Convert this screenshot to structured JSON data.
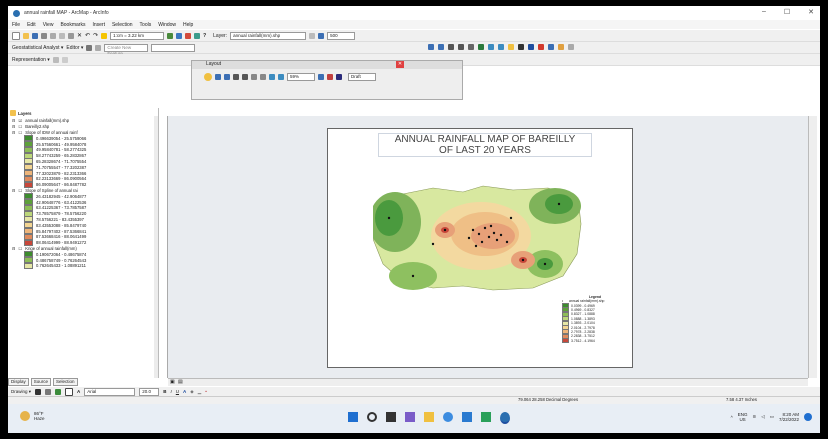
{
  "window": {
    "title": "annual rainfall MAP - ArcMap - ArcInfo",
    "minimize": "–",
    "maximize": "☐",
    "close": "✕"
  },
  "menu": [
    "File",
    "Edit",
    "View",
    "Bookmarks",
    "Insert",
    "Selection",
    "Tools",
    "Window",
    "Help"
  ],
  "toolbar1": {
    "scale": "1:cm = 3.22 km",
    "layer_label": "Layer:",
    "layer_value": "annual rainfall(mm).shp",
    "zoom": "500"
  },
  "toolbar2": {
    "geostat_label": "Geostatistical Analyst ▾",
    "editor_label": "Editor ▾",
    "task_label": "Create New Feature",
    "target_label": ""
  },
  "toolbar3": {
    "representation_label": "Representation ▾"
  },
  "layout_toolbar": {
    "title": "Layout",
    "zoom": "59%",
    "draft": "Draft"
  },
  "toc": {
    "title": "Layers",
    "items": [
      {
        "label": "annual rainfall(mm).shp",
        "kind": "layer",
        "checked": true
      },
      {
        "label": "Bareilly2.shp",
        "kind": "layer",
        "checked": false
      },
      {
        "label": "Slope of IDW of annual rainf",
        "kind": "layer",
        "checked": false
      },
      {
        "label": "0.496639054 - 25.5759066",
        "kind": "class",
        "color": "#3d8c2e"
      },
      {
        "label": "25.57560661 - 49.9584078",
        "kind": "class",
        "color": "#5ea13a"
      },
      {
        "label": "49.95840781 - 58.2774325",
        "kind": "class",
        "color": "#8dbe56"
      },
      {
        "label": "58.27743259 - 65.2832867",
        "kind": "class",
        "color": "#bcd77a"
      },
      {
        "label": "65.28328674 - 71.7075554",
        "kind": "class",
        "color": "#e6e7a6"
      },
      {
        "label": "71.70755547 - 77.3202387",
        "kind": "class",
        "color": "#f3d592"
      },
      {
        "label": "77.32023879 - 82.2313366",
        "kind": "class",
        "color": "#eeb57a"
      },
      {
        "label": "82.23133669 - 86.0900564",
        "kind": "class",
        "color": "#e08a5c"
      },
      {
        "label": "86.09005647 - 86.8487782",
        "kind": "class",
        "color": "#c8473a"
      },
      {
        "label": "Slope of Spline of annual rai",
        "kind": "layer",
        "checked": false
      },
      {
        "label": "26.43182945 - 42.9064877",
        "kind": "class",
        "color": "#3d8c2e"
      },
      {
        "label": "42.90648776 - 63.4122536",
        "kind": "class",
        "color": "#5ea13a"
      },
      {
        "label": "63.41225367 - 73.7857587",
        "kind": "class",
        "color": "#8dbe56"
      },
      {
        "label": "73.78575879 - 78.5756220",
        "kind": "class",
        "color": "#bcd77a"
      },
      {
        "label": "78.5756221 - 83.4355397",
        "kind": "class",
        "color": "#e6e7a6"
      },
      {
        "label": "83.43553088 - 85.8479740",
        "kind": "class",
        "color": "#f3d592"
      },
      {
        "label": "85.84797402 - 87.5366841",
        "kind": "class",
        "color": "#eeb57a"
      },
      {
        "label": "87.53668416 - 88.0641499",
        "kind": "class",
        "color": "#e08a5c"
      },
      {
        "label": "88.06414999 - 88.9491272",
        "kind": "class",
        "color": "#c8473a"
      },
      {
        "label": "Krige of annual rainfall(mm)",
        "kind": "layer",
        "checked": false
      },
      {
        "label": "0.190672064 - 0.48675874",
        "kind": "class",
        "color": "#3d8c2e"
      },
      {
        "label": "0.486758749 - 0.76264543",
        "kind": "class",
        "color": "#8dbe56"
      },
      {
        "label": "0.762645433 - 1.08891211",
        "kind": "class",
        "color": "#e6e7a6"
      }
    ]
  },
  "toc_tabs": [
    "Display",
    "Source",
    "Selection"
  ],
  "drawing_toolbar": {
    "drawing_label": "Drawing ▾",
    "font": "Arial",
    "size": "20.0",
    "bold": "B",
    "italic": "I",
    "underline": "U"
  },
  "map": {
    "title_line1": "ANNUAL RAINFALL MAP OF BAREILLY",
    "title_line2": "OF LAST 20 YEARS",
    "legend_title": "Legend",
    "legend_items": [
      {
        "label": "annual rainfall(mm).shp",
        "color": "#000000"
      },
      {
        "label": "0.0399 - 0.4969",
        "color": "#3d8c2e"
      },
      {
        "label": "0.4969 - 0.8327",
        "color": "#5ea13a"
      },
      {
        "label": "0.8327 - 1.0888",
        "color": "#8dbe56"
      },
      {
        "label": "1.0888 - 1.3893",
        "color": "#bcd77a"
      },
      {
        "label": "1.3893 - 2.0104",
        "color": "#e6e7a6"
      },
      {
        "label": "2.0104 - 2.7978",
        "color": "#f3d592"
      },
      {
        "label": "2.7978 - 2.2838",
        "color": "#eeb57a"
      },
      {
        "label": "2.2838 - 3.7512",
        "color": "#e08a5c"
      },
      {
        "label": "3.7512 - 4.1964",
        "color": "#c8473a"
      }
    ]
  },
  "status": {
    "coords": "79.064  28.258 Decimal Degrees",
    "page_coords": "7.58  4.37 Inches"
  },
  "taskbar": {
    "weather_temp": "86°F",
    "weather_desc": "Haze",
    "lang": "ENG",
    "region": "US",
    "time": "8:20 AM",
    "date": "7/22/2022"
  },
  "colors": {
    "accent": "#2a6fb0",
    "taskbar": "#e8eef5"
  }
}
